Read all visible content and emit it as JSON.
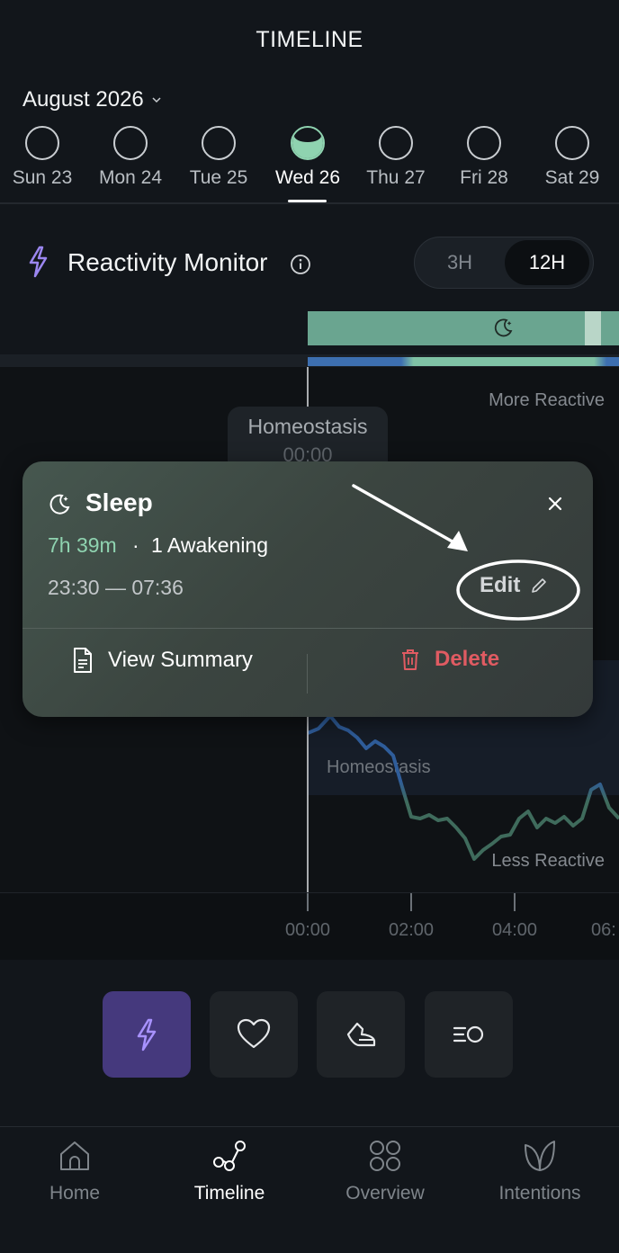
{
  "header": {
    "title": "TIMELINE",
    "month": "August 2026"
  },
  "days": [
    {
      "label": "Sun 23"
    },
    {
      "label": "Mon 24"
    },
    {
      "label": "Tue 25"
    },
    {
      "label": "Wed 26"
    },
    {
      "label": "Thu 27"
    },
    {
      "label": "Fri 28"
    },
    {
      "label": "Sat 29"
    }
  ],
  "monitor": {
    "title": "Reactivity Monitor",
    "range_options": [
      "3H",
      "12H"
    ],
    "selected_range": "12H"
  },
  "chart": {
    "more_reactive": "More Reactive",
    "less_reactive": "Less Reactive",
    "band_label": "Homeostasis",
    "tooltip_title": "Homeostasis",
    "tooltip_time": "00:00",
    "x_ticks": [
      "00:00",
      "02:00",
      "04:00",
      "06:"
    ]
  },
  "popup": {
    "title": "Sleep",
    "duration": "7h 39m",
    "separator": "·",
    "awakenings": "1 Awakening",
    "time_range": "23:30 — 07:36",
    "edit_label": "Edit",
    "view_summary_label": "View Summary",
    "delete_label": "Delete"
  },
  "colors": {
    "accent_green": "#8fd3b0",
    "delete_red": "#e05b62",
    "active_purple": "#45397d"
  },
  "quick_buttons": [
    "lightning-icon",
    "heart-icon",
    "shoe-icon",
    "list-circle-icon"
  ],
  "nav": [
    {
      "label": "Home",
      "icon": "home-icon"
    },
    {
      "label": "Timeline",
      "icon": "timeline-icon"
    },
    {
      "label": "Overview",
      "icon": "grid-icon"
    },
    {
      "label": "Intentions",
      "icon": "leaf-icon"
    }
  ],
  "active_nav": "Timeline"
}
